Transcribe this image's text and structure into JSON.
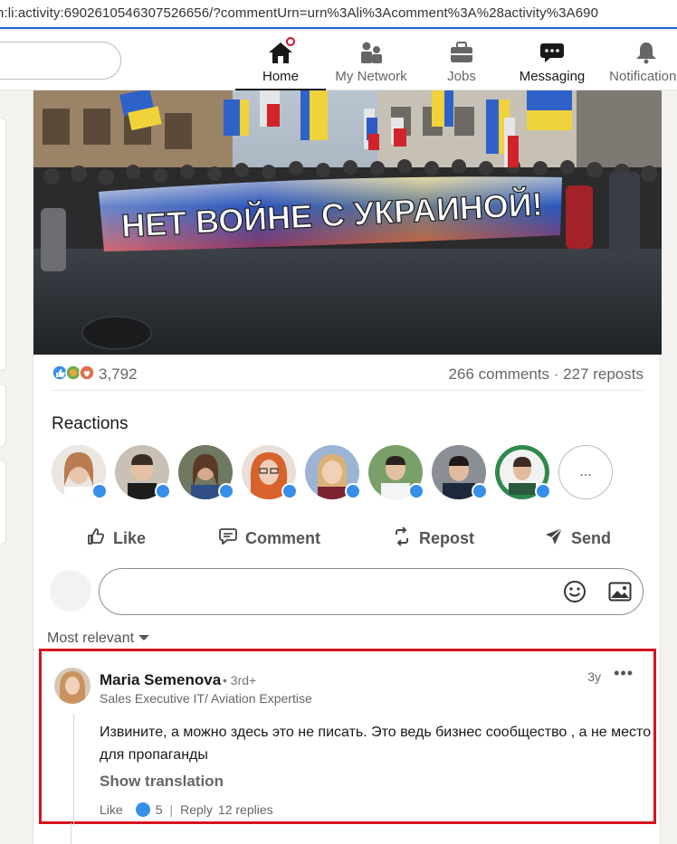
{
  "url": "n:li:activity:6902610546307526656/?commentUrn=urn%3Ali%3Acomment%3A%28activity%3A690",
  "nav": {
    "items": [
      {
        "label": "Home"
      },
      {
        "label": "My Network"
      },
      {
        "label": "Jobs"
      },
      {
        "label": "Messaging"
      },
      {
        "label": "Notifications"
      }
    ]
  },
  "post": {
    "banner_text": "НЕТ ВОЙНЕ С УКРАИНОЙ!",
    "reaction_count": "3,792",
    "comments_reposts": "266 comments · 227 reposts",
    "reactions_title": "Reactions",
    "more_reactors": "...",
    "actions": {
      "like": "Like",
      "comment": "Comment",
      "repost": "Repost",
      "send": "Send"
    },
    "sort_label": "Most relevant"
  },
  "comment": {
    "author": "Maria Semenova",
    "degree": "• 3rd+",
    "headline": "Sales Executive IT/ Aviation Expertise",
    "time": "3y",
    "more": "•••",
    "text": "Извините, а можно здесь это не писать. Это ведь бизнес сообщество , а не место для пропаганды",
    "translation": "Show translation",
    "like_label": "Like",
    "like_count": "5",
    "reply_label": "Reply",
    "replies": "12 replies"
  },
  "colors": {
    "accent": "#0a66c2",
    "highlight_border": "#d7141e",
    "notification_dot": "#cb112d"
  }
}
